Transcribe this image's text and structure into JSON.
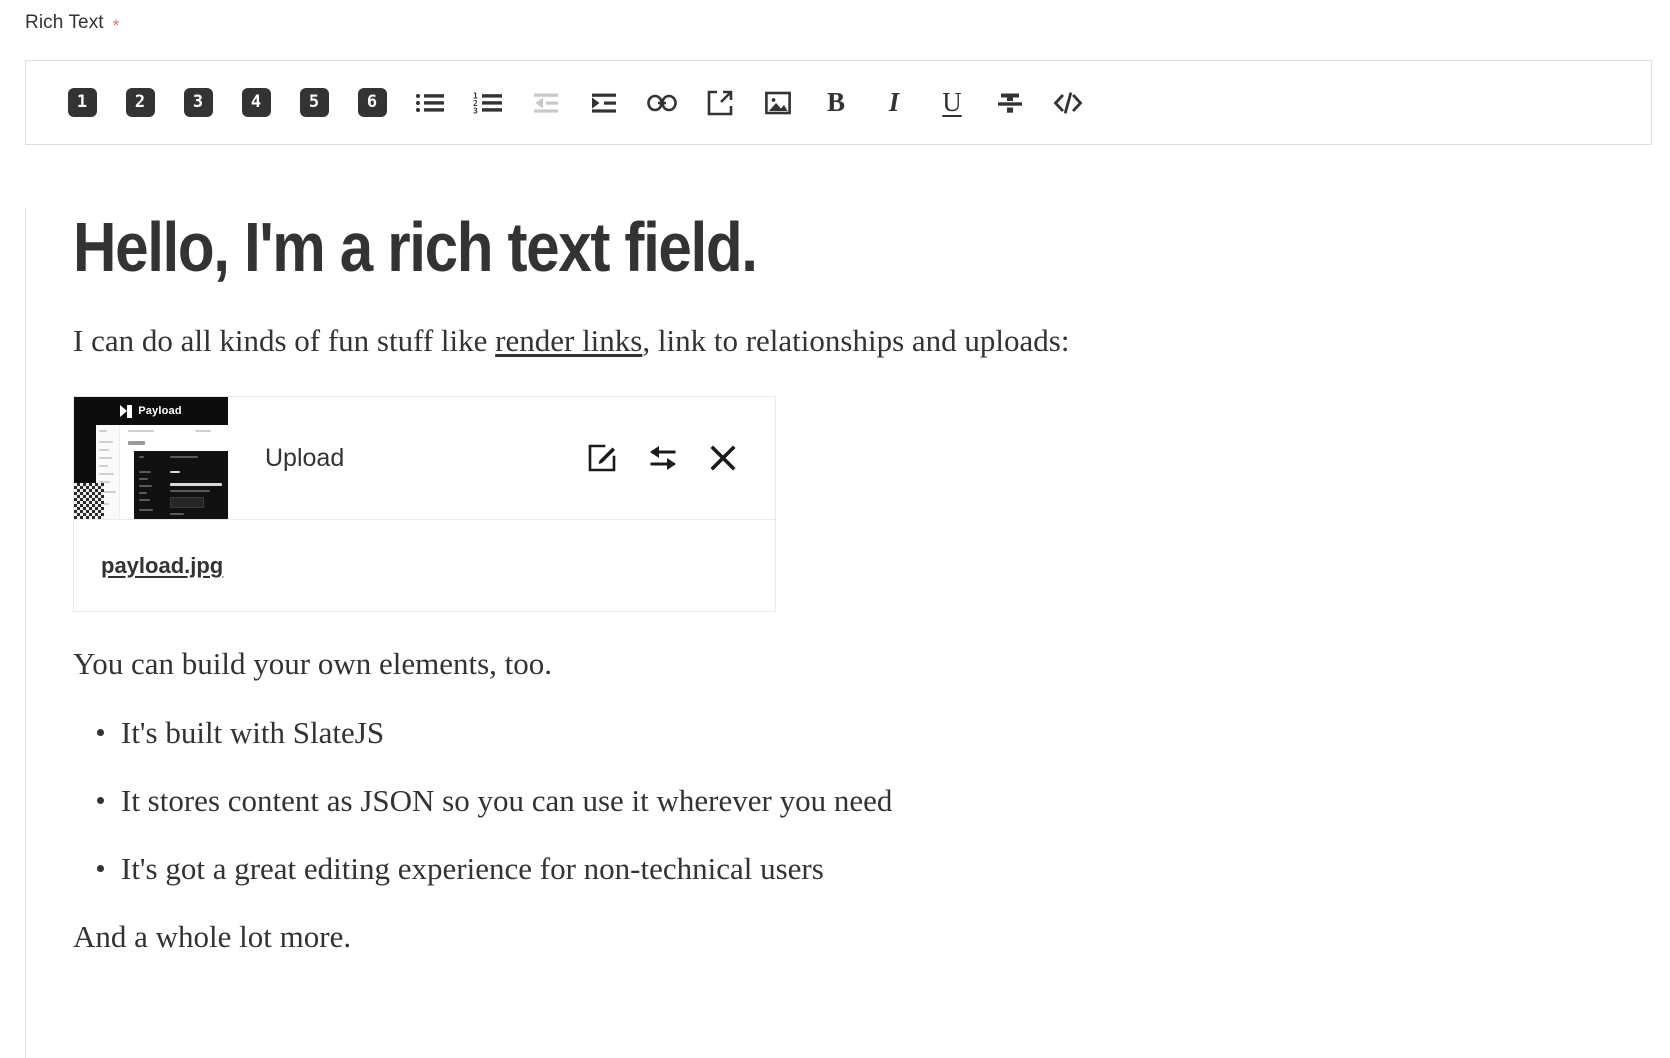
{
  "field": {
    "label": "Rich Text",
    "required_marker": "*"
  },
  "toolbar": {
    "headings": [
      {
        "name": "heading-1",
        "label": "1"
      },
      {
        "name": "heading-2",
        "label": "2"
      },
      {
        "name": "heading-3",
        "label": "3"
      },
      {
        "name": "heading-4",
        "label": "4"
      },
      {
        "name": "heading-5",
        "label": "5"
      },
      {
        "name": "heading-6",
        "label": "6"
      }
    ],
    "tools": [
      {
        "name": "unordered-list-icon",
        "enabled": true
      },
      {
        "name": "ordered-list-icon",
        "enabled": true
      },
      {
        "name": "indent-decrease-icon",
        "enabled": false
      },
      {
        "name": "indent-increase-icon",
        "enabled": true
      },
      {
        "name": "link-icon",
        "enabled": true
      },
      {
        "name": "relationship-icon",
        "enabled": true
      },
      {
        "name": "upload-image-icon",
        "enabled": true
      }
    ],
    "marks": [
      {
        "name": "bold-icon",
        "label": "B"
      },
      {
        "name": "italic-icon",
        "label": "I"
      },
      {
        "name": "underline-icon",
        "label": "U"
      },
      {
        "name": "strikethrough-icon",
        "label": "S"
      },
      {
        "name": "code-icon",
        "label": "</>"
      }
    ]
  },
  "content": {
    "heading": "Hello, I'm a rich text field.",
    "lead_before_link": "I can do all kinds of fun stuff like ",
    "lead_link": "render links",
    "lead_after_link": ", link to relationships and uploads:",
    "upload_card": {
      "thumbnail_brand": "Payload",
      "title": "Upload",
      "filename": "payload.jpg",
      "actions": [
        {
          "name": "edit-upload-button",
          "icon": "edit-icon"
        },
        {
          "name": "swap-upload-button",
          "icon": "swap-icon"
        },
        {
          "name": "remove-upload-button",
          "icon": "close-icon"
        }
      ]
    },
    "paragraph_after_card": "You can build your own elements, too.",
    "bullets": [
      "It's built with SlateJS",
      "It stores content as JSON so you can use it wherever you need",
      "It's got a great editing experience for non-technical users"
    ],
    "paragraph_tail": "And a whole lot more."
  },
  "colors": {
    "text": "#333333",
    "required": "#ea6b6b",
    "border": "#e0e0e0",
    "badge_bg": "#333333",
    "disabled_icon": "#c8c8c8"
  }
}
